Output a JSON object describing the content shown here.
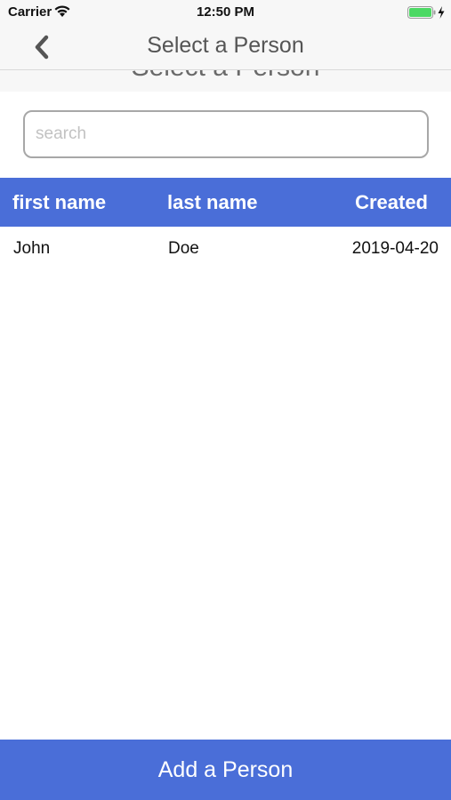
{
  "status_bar": {
    "carrier": "Carrier",
    "time": "12:50 PM",
    "wifi_icon": "wifi-icon",
    "battery_icon": "battery-charging-icon",
    "battery_color": "#4cd964"
  },
  "nav": {
    "back_icon": "chevron-left-icon",
    "title": "Select a Person",
    "large_title": "Select a Person"
  },
  "search": {
    "value": "",
    "placeholder": "search"
  },
  "table": {
    "columns": [
      "first name",
      "last name",
      "Created"
    ],
    "rows": [
      {
        "first_name": "John",
        "last_name": "Doe",
        "created": "2019-04-20"
      }
    ]
  },
  "footer": {
    "add_label": "Add a Person"
  },
  "colors": {
    "accent": "#4a6ed8",
    "nav_background": "#f7f7f7",
    "search_border": "#a7a7a7"
  }
}
